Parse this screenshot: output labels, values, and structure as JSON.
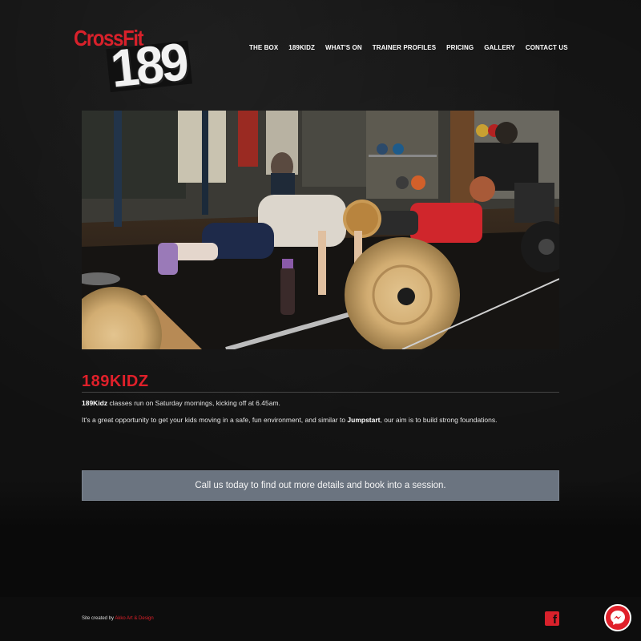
{
  "brand": {
    "logo_top": "CrossFit",
    "logo_number": "189"
  },
  "nav": {
    "items": [
      "THE BOX",
      "189KIDZ",
      "WHAT'S ON",
      "TRAINER PROFILES",
      "PRICING",
      "GALLERY",
      "CONTACT US"
    ]
  },
  "hero": {
    "alt": "Kids doing push-ups at CrossFit 189 gym"
  },
  "content": {
    "title": "189KIDZ",
    "p1_bold": "189Kidz",
    "p1_rest": " classes run on Saturday mornings, kicking off at 6.45am.",
    "p2_start": "It's a great opportunity to get your kids moving in a safe, fun environment, and similar to ",
    "p2_bold": "Jumpstart",
    "p2_end": ", our aim is to build strong foundations.",
    "cta": "Call us today to find out more details and book into a session."
  },
  "footer": {
    "credit_prefix": "Site created by ",
    "credit_link": "Akko Art & Design",
    "facebook_icon": "facebook-icon",
    "messenger_icon": "messenger-icon"
  },
  "colors": {
    "accent": "#e0202a",
    "cta_bg": "#6b7480",
    "page_bg": "#111111"
  }
}
